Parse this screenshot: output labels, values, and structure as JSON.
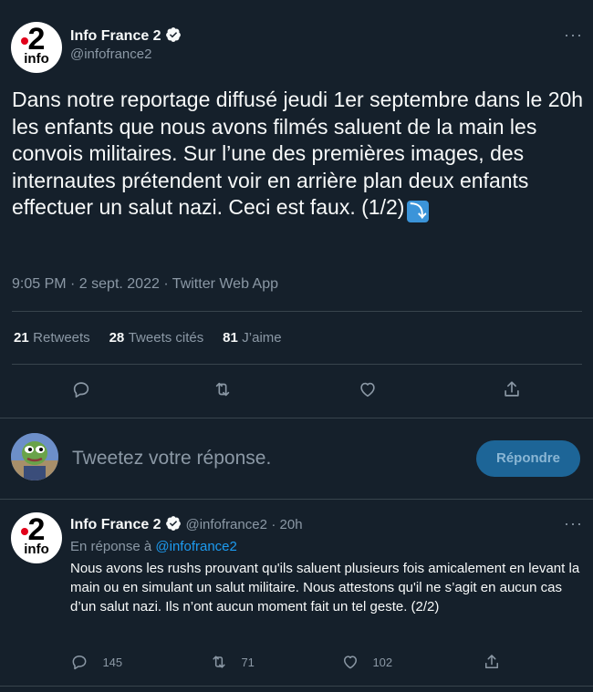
{
  "tweet": {
    "author_name": "Info France 2",
    "author_handle": "@infofrance2",
    "avatar_number": "2",
    "avatar_label": "info",
    "text": "Dans notre reportage diffusé jeudi 1er septembre dans le 20h les enfants que nous avons filmés saluent de la main les convois militaires. Sur l’une des premières images, des internautes prétendent voir en arrière plan deux enfants effectuer un salut nazi. Ceci est faux. (1/2)",
    "arrow_emoji": "⤵",
    "time": "9:05 PM · 2 sept. 2022 · Twitter Web App",
    "more_icon": "more-icon",
    "stats": {
      "retweets_count": "21",
      "retweets_label": "Retweets",
      "quotes_count": "28",
      "quotes_label": "Tweets cités",
      "likes_count": "81",
      "likes_label": "J’aime"
    },
    "actions": [
      "reply-icon",
      "retweet-icon",
      "like-icon",
      "share-icon"
    ]
  },
  "compose": {
    "placeholder": "Tweetez votre réponse.",
    "button_label": "Répondre"
  },
  "reply": {
    "author_name": "Info France 2",
    "author_handle": "@infofrance2",
    "age": "· 20h",
    "in_reply_prefix": "En réponse à",
    "in_reply_handle": "@infofrance2",
    "text": "Nous avons les rushs prouvant qu'ils saluent plusieurs fois amicalement en levant la main ou en simulant un salut militaire. Nous attestons qu'il ne s’agit en aucun cas d’un salut nazi. Ils n’ont aucun moment fait un tel geste. (2/2)",
    "reply_count": "145",
    "retweet_count": "71",
    "like_count": "102"
  },
  "colors": {
    "background": "#15202b",
    "accent": "#1d9bf0",
    "muted": "#8b98a5",
    "divider": "#38444d"
  }
}
